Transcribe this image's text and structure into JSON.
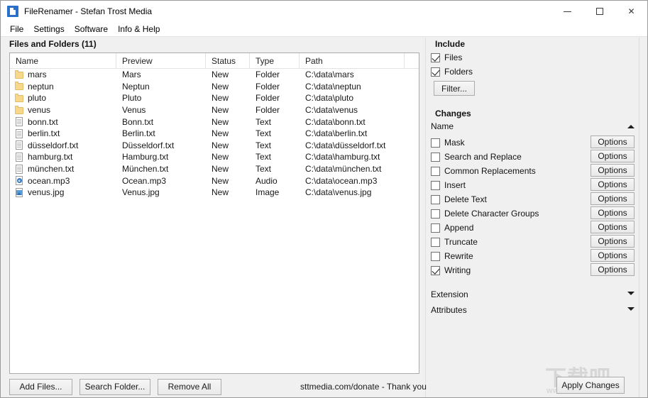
{
  "window": {
    "title": "FileRenamer - Stefan Trost Media",
    "icon": "document-icon",
    "controls": {
      "minimize": "minimize-icon",
      "maximize": "maximize-icon",
      "close": "close-icon"
    }
  },
  "menubar": {
    "items": [
      {
        "label": "File"
      },
      {
        "label": "Settings"
      },
      {
        "label": "Software"
      },
      {
        "label": "Info & Help"
      }
    ]
  },
  "filelist": {
    "caption": "Files and Folders (11)",
    "columns": [
      "Name",
      "Preview",
      "Status",
      "Type",
      "Path"
    ],
    "rows": [
      {
        "icon": "folder",
        "name": "mars",
        "preview": "Mars",
        "status": "New",
        "type": "Folder",
        "path": "C:\\data\\mars"
      },
      {
        "icon": "folder",
        "name": "neptun",
        "preview": "Neptun",
        "status": "New",
        "type": "Folder",
        "path": "C:\\data\\neptun"
      },
      {
        "icon": "folder",
        "name": "pluto",
        "preview": "Pluto",
        "status": "New",
        "type": "Folder",
        "path": "C:\\data\\pluto"
      },
      {
        "icon": "folder",
        "name": "venus",
        "preview": "Venus",
        "status": "New",
        "type": "Folder",
        "path": "C:\\data\\venus"
      },
      {
        "icon": "doc",
        "name": "bonn.txt",
        "preview": "Bonn.txt",
        "status": "New",
        "type": "Text",
        "path": "C:\\data\\bonn.txt"
      },
      {
        "icon": "doc",
        "name": "berlin.txt",
        "preview": "Berlin.txt",
        "status": "New",
        "type": "Text",
        "path": "C:\\data\\berlin.txt"
      },
      {
        "icon": "doc",
        "name": "düsseldorf.txt",
        "preview": "Düsseldorf.txt",
        "status": "New",
        "type": "Text",
        "path": "C:\\data\\düsseldorf.txt"
      },
      {
        "icon": "doc",
        "name": "hamburg.txt",
        "preview": "Hamburg.txt",
        "status": "New",
        "type": "Text",
        "path": "C:\\data\\hamburg.txt"
      },
      {
        "icon": "doc",
        "name": "münchen.txt",
        "preview": "München.txt",
        "status": "New",
        "type": "Text",
        "path": "C:\\data\\münchen.txt"
      },
      {
        "icon": "audio",
        "name": "ocean.mp3",
        "preview": "Ocean.mp3",
        "status": "New",
        "type": "Audio",
        "path": "C:\\data\\ocean.mp3"
      },
      {
        "icon": "image",
        "name": "venus.jpg",
        "preview": "Venus.jpg",
        "status": "New",
        "type": "Image",
        "path": "C:\\data\\venus.jpg"
      }
    ]
  },
  "bottombar": {
    "add_files_label": "Add Files...",
    "search_folder_label": "Search Folder...",
    "remove_all_label": "Remove All",
    "donate_text": "sttmedia.com/donate - Thank you"
  },
  "include": {
    "title": "Include",
    "files": {
      "label": "Files",
      "checked": true
    },
    "folders": {
      "label": "Folders",
      "checked": true
    },
    "filter_label": "Filter..."
  },
  "changes": {
    "title": "Changes",
    "group_label": "Name",
    "group_expanded": true,
    "options_label": "Options",
    "items": [
      {
        "label": "Mask",
        "checked": false,
        "options": "Options"
      },
      {
        "label": "Search and Replace",
        "checked": false,
        "options": "Options"
      },
      {
        "label": "Common Replacements",
        "checked": false,
        "options": "Options"
      },
      {
        "label": "Insert",
        "checked": false,
        "options": "Options"
      },
      {
        "label": "Delete Text",
        "checked": false,
        "options": "Options"
      },
      {
        "label": "Delete Character Groups",
        "checked": false,
        "options": "Options"
      },
      {
        "label": "Append",
        "checked": false,
        "options": "Options"
      },
      {
        "label": "Truncate",
        "checked": false,
        "options": "Options"
      },
      {
        "label": "Rewrite",
        "checked": false,
        "options": "Options"
      },
      {
        "label": "Writing",
        "checked": true,
        "options": "Options"
      }
    ],
    "collapsed_sections": [
      {
        "label": "Extension"
      },
      {
        "label": "Attributes"
      }
    ]
  },
  "apply": {
    "label": "Apply Changes"
  },
  "watermark": {
    "cn": "下载吧",
    "url": "www.xiazaiba.com"
  },
  "colors": {
    "window_bg": "#f0f0f0",
    "titlebar_bg": "#ffffff",
    "list_bg": "#ffffff",
    "border": "#ababab",
    "accent": "#0078d7",
    "folder_icon": "#f7d88a",
    "text": "#1a1a1a"
  }
}
